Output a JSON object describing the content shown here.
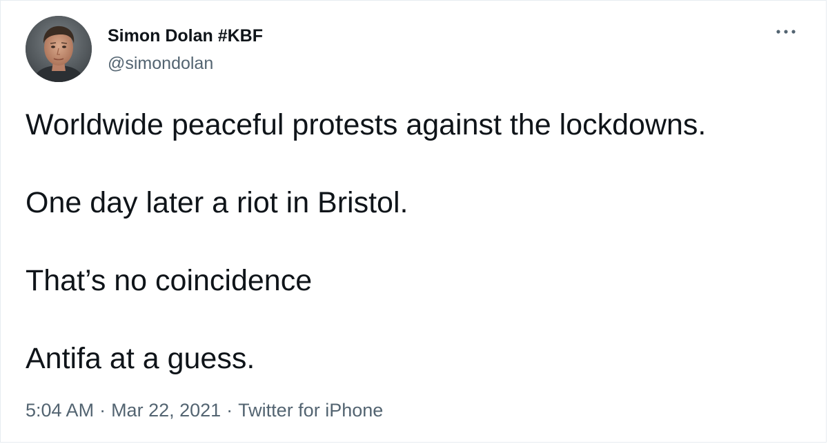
{
  "tweet": {
    "author": {
      "display_name": "Simon Dolan #KBF",
      "handle": "@simondolan",
      "avatar_icon": "profile-photo"
    },
    "more_icon": "more-options-icon",
    "text_lines": [
      "Worldwide peaceful protests against the lockdowns.",
      "One day later a riot in Bristol.",
      "That’s no coincidence",
      "Antifa at a guess."
    ],
    "meta": {
      "time": "5:04 AM",
      "separator": "·",
      "date": "Mar 22, 2021",
      "source": "Twitter for iPhone"
    }
  },
  "colors": {
    "text_primary": "#0f1419",
    "text_secondary": "#536471",
    "border": "#e6ecf0",
    "background": "#ffffff"
  }
}
